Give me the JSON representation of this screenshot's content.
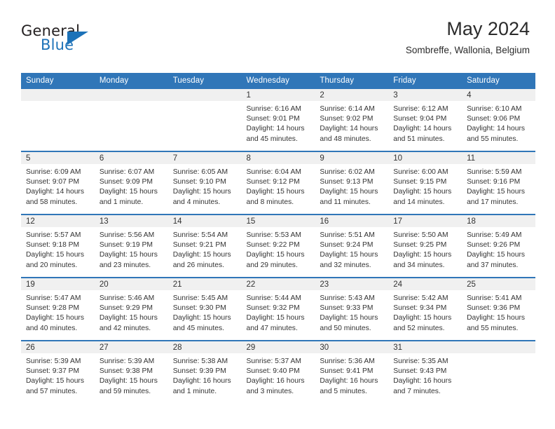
{
  "brand": {
    "word_one": "General",
    "word_two": "Blue",
    "triangle_icon": "triangle-icon",
    "color_dark": "#231f20",
    "color_blue": "#1d72b8"
  },
  "header": {
    "month_title": "May 2024",
    "location": "Sombreffe, Wallonia, Belgium"
  },
  "theme": {
    "header_blue": "#3076b8",
    "day_band_gray": "#f0f0f0",
    "text": "#333333"
  },
  "calendar": {
    "weekday_headers": [
      "Sunday",
      "Monday",
      "Tuesday",
      "Wednesday",
      "Thursday",
      "Friday",
      "Saturday"
    ],
    "weeks": [
      [
        {
          "day": "",
          "lines": []
        },
        {
          "day": "",
          "lines": []
        },
        {
          "day": "",
          "lines": []
        },
        {
          "day": "1",
          "lines": [
            "Sunrise: 6:16 AM",
            "Sunset: 9:01 PM",
            "Daylight: 14 hours",
            "and 45 minutes."
          ]
        },
        {
          "day": "2",
          "lines": [
            "Sunrise: 6:14 AM",
            "Sunset: 9:02 PM",
            "Daylight: 14 hours",
            "and 48 minutes."
          ]
        },
        {
          "day": "3",
          "lines": [
            "Sunrise: 6:12 AM",
            "Sunset: 9:04 PM",
            "Daylight: 14 hours",
            "and 51 minutes."
          ]
        },
        {
          "day": "4",
          "lines": [
            "Sunrise: 6:10 AM",
            "Sunset: 9:06 PM",
            "Daylight: 14 hours",
            "and 55 minutes."
          ]
        }
      ],
      [
        {
          "day": "5",
          "lines": [
            "Sunrise: 6:09 AM",
            "Sunset: 9:07 PM",
            "Daylight: 14 hours",
            "and 58 minutes."
          ]
        },
        {
          "day": "6",
          "lines": [
            "Sunrise: 6:07 AM",
            "Sunset: 9:09 PM",
            "Daylight: 15 hours",
            "and 1 minute."
          ]
        },
        {
          "day": "7",
          "lines": [
            "Sunrise: 6:05 AM",
            "Sunset: 9:10 PM",
            "Daylight: 15 hours",
            "and 4 minutes."
          ]
        },
        {
          "day": "8",
          "lines": [
            "Sunrise: 6:04 AM",
            "Sunset: 9:12 PM",
            "Daylight: 15 hours",
            "and 8 minutes."
          ]
        },
        {
          "day": "9",
          "lines": [
            "Sunrise: 6:02 AM",
            "Sunset: 9:13 PM",
            "Daylight: 15 hours",
            "and 11 minutes."
          ]
        },
        {
          "day": "10",
          "lines": [
            "Sunrise: 6:00 AM",
            "Sunset: 9:15 PM",
            "Daylight: 15 hours",
            "and 14 minutes."
          ]
        },
        {
          "day": "11",
          "lines": [
            "Sunrise: 5:59 AM",
            "Sunset: 9:16 PM",
            "Daylight: 15 hours",
            "and 17 minutes."
          ]
        }
      ],
      [
        {
          "day": "12",
          "lines": [
            "Sunrise: 5:57 AM",
            "Sunset: 9:18 PM",
            "Daylight: 15 hours",
            "and 20 minutes."
          ]
        },
        {
          "day": "13",
          "lines": [
            "Sunrise: 5:56 AM",
            "Sunset: 9:19 PM",
            "Daylight: 15 hours",
            "and 23 minutes."
          ]
        },
        {
          "day": "14",
          "lines": [
            "Sunrise: 5:54 AM",
            "Sunset: 9:21 PM",
            "Daylight: 15 hours",
            "and 26 minutes."
          ]
        },
        {
          "day": "15",
          "lines": [
            "Sunrise: 5:53 AM",
            "Sunset: 9:22 PM",
            "Daylight: 15 hours",
            "and 29 minutes."
          ]
        },
        {
          "day": "16",
          "lines": [
            "Sunrise: 5:51 AM",
            "Sunset: 9:24 PM",
            "Daylight: 15 hours",
            "and 32 minutes."
          ]
        },
        {
          "day": "17",
          "lines": [
            "Sunrise: 5:50 AM",
            "Sunset: 9:25 PM",
            "Daylight: 15 hours",
            "and 34 minutes."
          ]
        },
        {
          "day": "18",
          "lines": [
            "Sunrise: 5:49 AM",
            "Sunset: 9:26 PM",
            "Daylight: 15 hours",
            "and 37 minutes."
          ]
        }
      ],
      [
        {
          "day": "19",
          "lines": [
            "Sunrise: 5:47 AM",
            "Sunset: 9:28 PM",
            "Daylight: 15 hours",
            "and 40 minutes."
          ]
        },
        {
          "day": "20",
          "lines": [
            "Sunrise: 5:46 AM",
            "Sunset: 9:29 PM",
            "Daylight: 15 hours",
            "and 42 minutes."
          ]
        },
        {
          "day": "21",
          "lines": [
            "Sunrise: 5:45 AM",
            "Sunset: 9:30 PM",
            "Daylight: 15 hours",
            "and 45 minutes."
          ]
        },
        {
          "day": "22",
          "lines": [
            "Sunrise: 5:44 AM",
            "Sunset: 9:32 PM",
            "Daylight: 15 hours",
            "and 47 minutes."
          ]
        },
        {
          "day": "23",
          "lines": [
            "Sunrise: 5:43 AM",
            "Sunset: 9:33 PM",
            "Daylight: 15 hours",
            "and 50 minutes."
          ]
        },
        {
          "day": "24",
          "lines": [
            "Sunrise: 5:42 AM",
            "Sunset: 9:34 PM",
            "Daylight: 15 hours",
            "and 52 minutes."
          ]
        },
        {
          "day": "25",
          "lines": [
            "Sunrise: 5:41 AM",
            "Sunset: 9:36 PM",
            "Daylight: 15 hours",
            "and 55 minutes."
          ]
        }
      ],
      [
        {
          "day": "26",
          "lines": [
            "Sunrise: 5:39 AM",
            "Sunset: 9:37 PM",
            "Daylight: 15 hours",
            "and 57 minutes."
          ]
        },
        {
          "day": "27",
          "lines": [
            "Sunrise: 5:39 AM",
            "Sunset: 9:38 PM",
            "Daylight: 15 hours",
            "and 59 minutes."
          ]
        },
        {
          "day": "28",
          "lines": [
            "Sunrise: 5:38 AM",
            "Sunset: 9:39 PM",
            "Daylight: 16 hours",
            "and 1 minute."
          ]
        },
        {
          "day": "29",
          "lines": [
            "Sunrise: 5:37 AM",
            "Sunset: 9:40 PM",
            "Daylight: 16 hours",
            "and 3 minutes."
          ]
        },
        {
          "day": "30",
          "lines": [
            "Sunrise: 5:36 AM",
            "Sunset: 9:41 PM",
            "Daylight: 16 hours",
            "and 5 minutes."
          ]
        },
        {
          "day": "31",
          "lines": [
            "Sunrise: 5:35 AM",
            "Sunset: 9:43 PM",
            "Daylight: 16 hours",
            "and 7 minutes."
          ]
        },
        {
          "day": "",
          "lines": []
        }
      ]
    ]
  }
}
